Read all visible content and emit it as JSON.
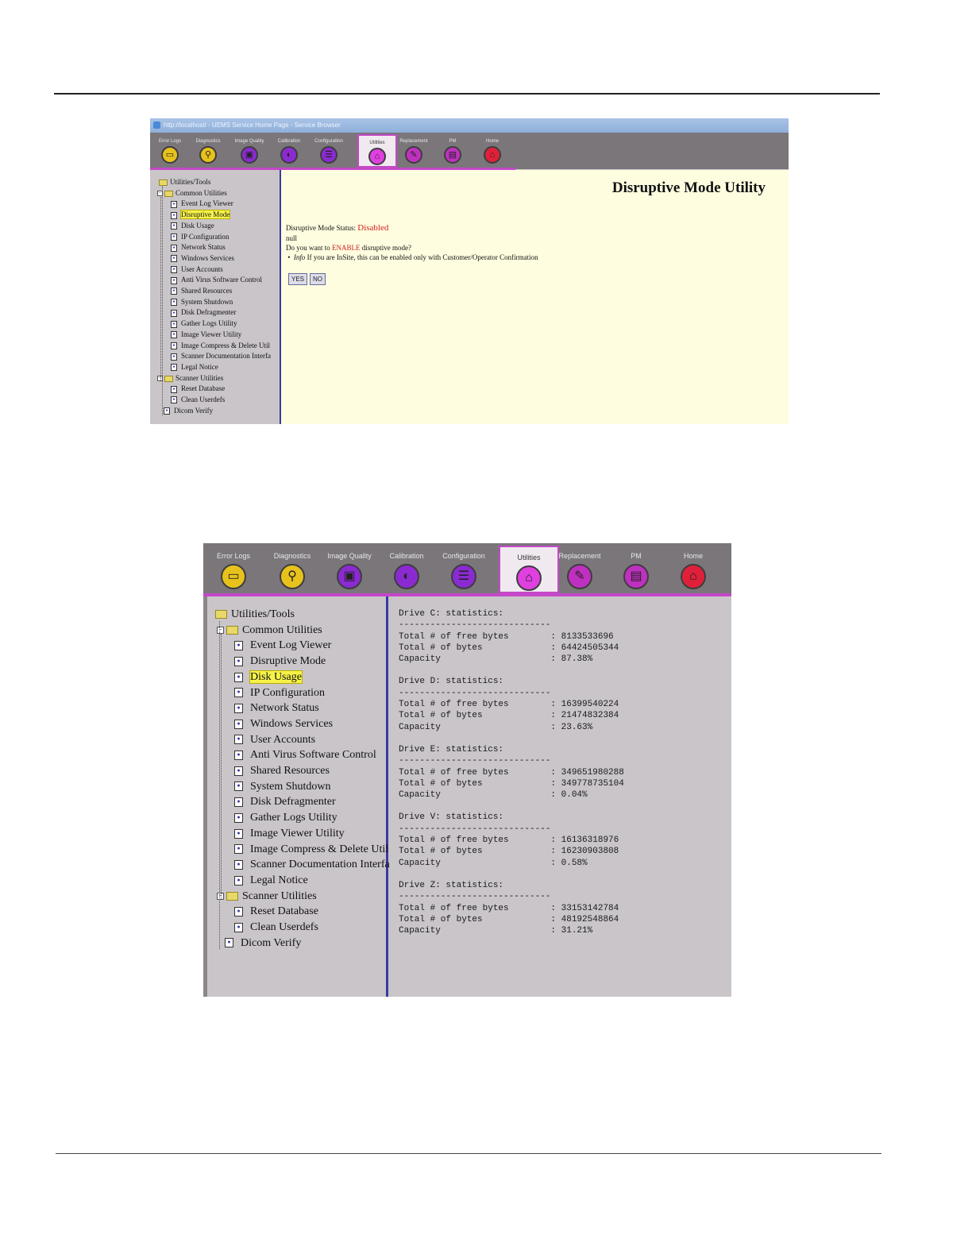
{
  "nav_tabs": [
    {
      "label": "Error Logs",
      "color": "#e7c21c",
      "icon": "log-icon"
    },
    {
      "label": "Diagnostics",
      "color": "#e7c21c",
      "icon": "stethoscope-icon"
    },
    {
      "label": "Image Quality",
      "color": "#8a2ad0",
      "icon": "image-icon"
    },
    {
      "label": "Calibration",
      "color": "#8a2ad0",
      "icon": "calibration-icon"
    },
    {
      "label": "Configuration",
      "color": "#8a2ad0",
      "icon": "config-icon"
    },
    {
      "label": "Utilities",
      "color": "#e040e0",
      "icon": "toolbox-icon"
    },
    {
      "label": "Replacement",
      "color": "#c030c0",
      "icon": "wrench-icon"
    },
    {
      "label": "PM",
      "color": "#c030c0",
      "icon": "checklist-icon"
    },
    {
      "label": "Home",
      "color": "#e0203a",
      "icon": "home-icon"
    }
  ],
  "tree": {
    "root": "Utilities/Tools",
    "common_label": "Common Utilities",
    "common": [
      "Event Log Viewer",
      "Disruptive Mode",
      "Disk Usage",
      "IP Configuration",
      "Network Status",
      "Windows Services",
      "User Accounts",
      "Anti Virus Software Control",
      "Shared Resources",
      "System Shutdown",
      "Disk Defragmenter",
      "Gather Logs Utility",
      "Image Viewer Utility",
      "Image Compress & Delete Util",
      "Scanner Documentation Interfa",
      "Legal Notice"
    ],
    "scanner_label": "Scanner Utilities",
    "scanner": [
      "Reset Database",
      "Clean Userdefs"
    ],
    "dicom": "Dicom Verify"
  },
  "shot1": {
    "window_title": "http://localhost/ - UEMS Service Home Page - Service Browser",
    "selected_index": 1,
    "title": "Disruptive Mode Utility",
    "status_label": "Disruptive Mode Status: ",
    "status_value": "Disabled",
    "null_text": "null",
    "question_pre": "Do you want to ",
    "question_enable": "ENABLE",
    "question_post": " disruptive mode?",
    "info_bullet": "•",
    "info_label": "Info",
    "info_text": " If you are InSite, this can be enabled only with Customer/Operator Confirmation",
    "yes": "YES",
    "no": "NO"
  },
  "shot2": {
    "selected_index": 2,
    "drives": [
      {
        "header": "Drive C: statistics:",
        "divider": "-----------------------------",
        "rows": [
          "Total # of free bytes        : 8133533696",
          "Total # of bytes             : 64424505344",
          "Capacity                     : 87.38%"
        ]
      },
      {
        "header": "Drive D: statistics:",
        "divider": "-----------------------------",
        "rows": [
          "Total # of free bytes        : 16399540224",
          "Total # of bytes             : 21474832384",
          "Capacity                     : 23.63%"
        ]
      },
      {
        "header": "Drive E: statistics:",
        "divider": "-----------------------------",
        "rows": [
          "Total # of free bytes        : 349651980288",
          "Total # of bytes             : 349778735104",
          "Capacity                     : 0.04%"
        ]
      },
      {
        "header": "Drive V: statistics:",
        "divider": "-----------------------------",
        "rows": [
          "Total # of free bytes        : 16136318976",
          "Total # of bytes             : 16230903808",
          "Capacity                     : 0.58%"
        ]
      },
      {
        "header": "Drive Z: statistics:",
        "divider": "-----------------------------",
        "rows": [
          "Total # of free bytes        : 33153142784",
          "Total # of bytes             : 48192548864",
          "Capacity                     : 31.21%"
        ]
      }
    ]
  }
}
